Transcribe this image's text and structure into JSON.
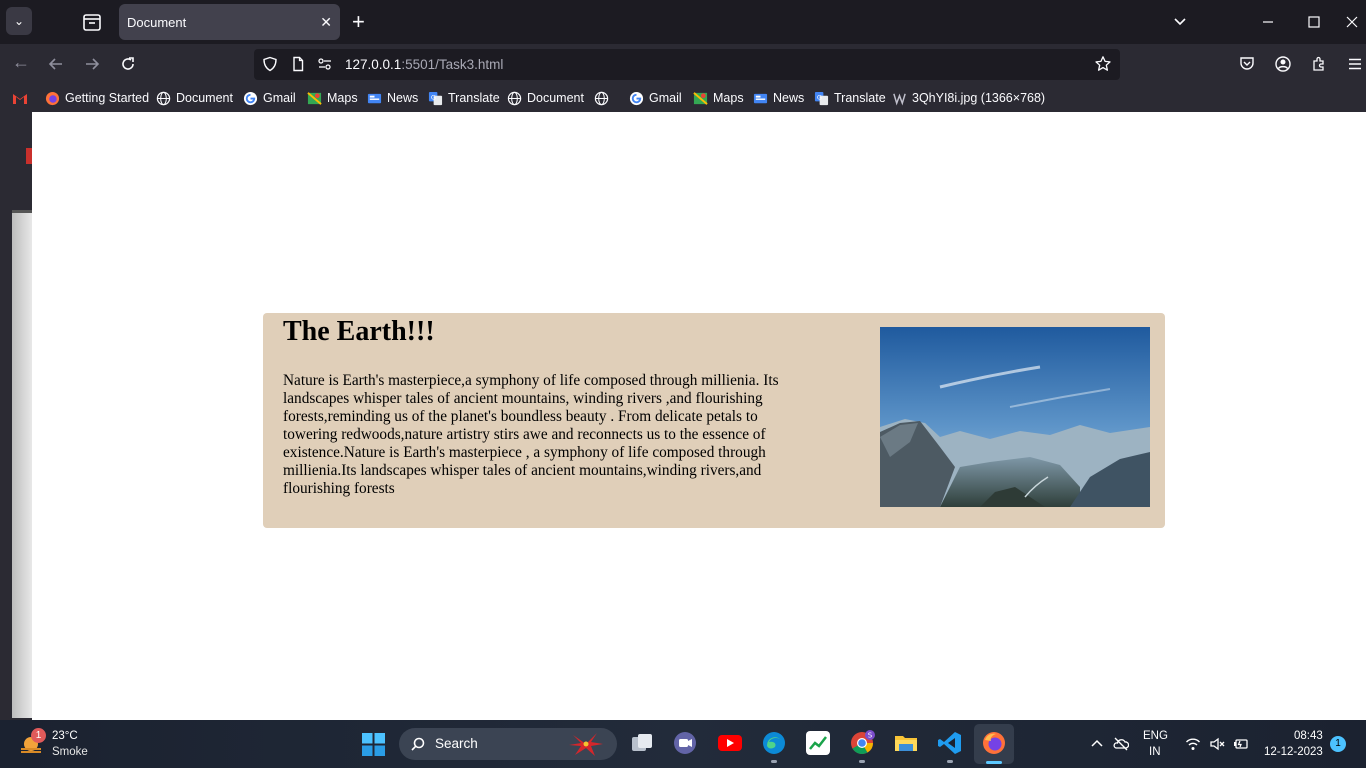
{
  "browser": {
    "tab": {
      "title": "Document"
    },
    "url": {
      "host": "127.0.0.1",
      "rest": ":5501/Task3.html"
    },
    "bookmarks": [
      {
        "label": "Getting Started",
        "icon": "firefox-icon"
      },
      {
        "label": "Document",
        "icon": "globe-icon"
      },
      {
        "label": "Gmail",
        "icon": "google-icon"
      },
      {
        "label": "Maps",
        "icon": "maps-icon"
      },
      {
        "label": "News",
        "icon": "news-icon"
      },
      {
        "label": "Translate",
        "icon": "translate-icon"
      },
      {
        "label": "Document",
        "icon": "globe-icon"
      },
      {
        "label": "",
        "icon": "globe-icon"
      },
      {
        "label": "Gmail",
        "icon": "google-icon"
      },
      {
        "label": "Maps",
        "icon": "maps-icon"
      },
      {
        "label": "News",
        "icon": "news-icon"
      },
      {
        "label": "Translate",
        "icon": "translate-icon"
      },
      {
        "label": "3QhYI8i.jpg (1366×768)",
        "icon": "image-icon"
      }
    ]
  },
  "page": {
    "title": "The Earth!!!",
    "paragraph": "Nature is Earth's masterpiece,a symphony of life composed through millienia. Its landscapes whisper tales of ancient mountains, winding rivers ,and flourishing forests,reminding us of the planet's boundless beauty . From delicate petals to towering redwoods,nature artistry stirs awe and reconnects us to the essence of existence.Nature is Earth's masterpiece , a symphony of life composed through millienia.Its landscapes whisper tales of ancient mountains,winding rivers,and flourishing forests"
  },
  "taskbar": {
    "weather": {
      "temp": "23°C",
      "desc": "Smoke",
      "badge": "1"
    },
    "search_label": "Search",
    "lang": {
      "line1": "ENG",
      "line2": "IN"
    },
    "clock": {
      "time": "08:43",
      "date": "12-12-2023"
    },
    "notifications": "1"
  },
  "colors": {
    "card_background": "#e0cfb9",
    "tabstrip": "#1c1b22",
    "toolbar": "#2b2a33",
    "active_indicator": "#5cc8ff"
  }
}
